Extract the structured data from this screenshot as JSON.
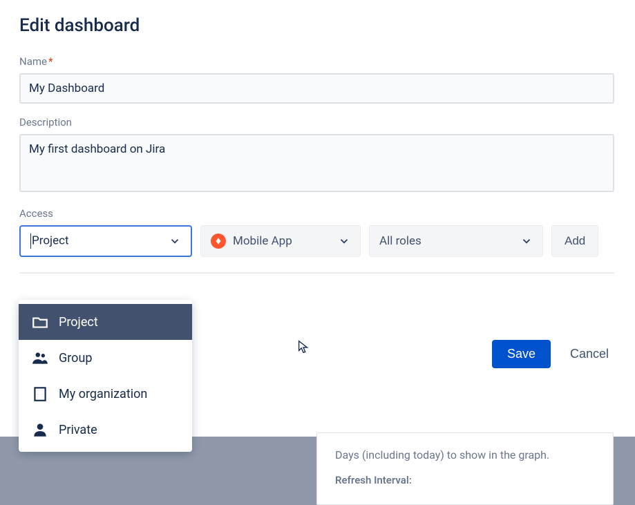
{
  "modal": {
    "title": "Edit dashboard",
    "name_label": "Name",
    "name_value": "My Dashboard",
    "description_label": "Description",
    "description_value": "My first dashboard on Jira",
    "access_label": "Access"
  },
  "access": {
    "type_value": "Project",
    "project_value": "Mobile App",
    "roles_value": "All roles",
    "add_label": "Add"
  },
  "dropdown": {
    "items": [
      {
        "label": "Project"
      },
      {
        "label": "Group"
      },
      {
        "label": "My organization"
      },
      {
        "label": "Private"
      }
    ]
  },
  "footer": {
    "save": "Save",
    "cancel": "Cancel"
  },
  "background": {
    "hint": "Days (including today) to show in the graph.",
    "refresh_label": "Refresh Interval:"
  }
}
